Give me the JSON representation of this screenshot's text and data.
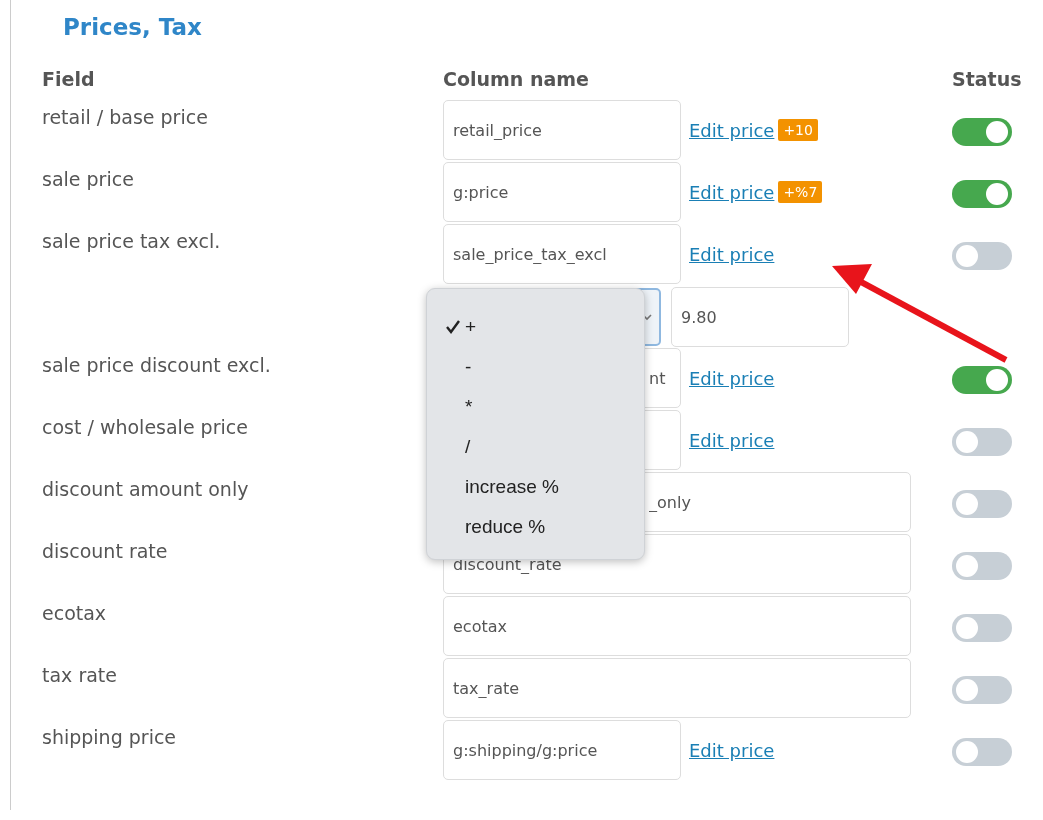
{
  "section": {
    "title": "Prices, Tax"
  },
  "columns": [
    "Field",
    "Column name",
    "Status"
  ],
  "rows": [
    {
      "kind": "field",
      "label": "retail / base price",
      "column": "retail_price",
      "link": "Edit price",
      "badge": "+10",
      "on": true
    },
    {
      "kind": "field",
      "label": "sale price",
      "column": "g:price",
      "link": "Edit price",
      "badge": "+%7",
      "on": true
    },
    {
      "kind": "field",
      "label": "sale price tax excl.",
      "column": "sale_price_tax_excl",
      "link": "Edit price",
      "on": false
    },
    {
      "kind": "editor",
      "amount": "9.80",
      "menu": [
        {
          "label": "+",
          "selected": true
        },
        {
          "label": "-",
          "selected": false
        },
        {
          "label": "*",
          "selected": false
        },
        {
          "label": "/",
          "selected": false
        },
        {
          "label": "increase %",
          "selected": false
        },
        {
          "label": "reduce %",
          "selected": false
        }
      ]
    },
    {
      "kind": "field",
      "label": "sale price discount excl.",
      "column": "nt",
      "covered": true,
      "link": "Edit price",
      "on": true
    },
    {
      "kind": "field",
      "label": "cost / wholesale price",
      "link": "Edit price",
      "on": false
    },
    {
      "kind": "field",
      "label": "discount amount only",
      "column": "_only",
      "covered": true,
      "on": false
    },
    {
      "kind": "field",
      "label": "discount rate",
      "column": "discount_rate",
      "on": false
    },
    {
      "kind": "field",
      "label": "ecotax",
      "column": "ecotax",
      "on": false
    },
    {
      "kind": "field",
      "label": "tax rate",
      "column": "tax_rate",
      "on": false
    },
    {
      "kind": "field",
      "label": "shipping price",
      "column": "g:shipping/g:price",
      "link": "Edit price",
      "on": false
    }
  ]
}
